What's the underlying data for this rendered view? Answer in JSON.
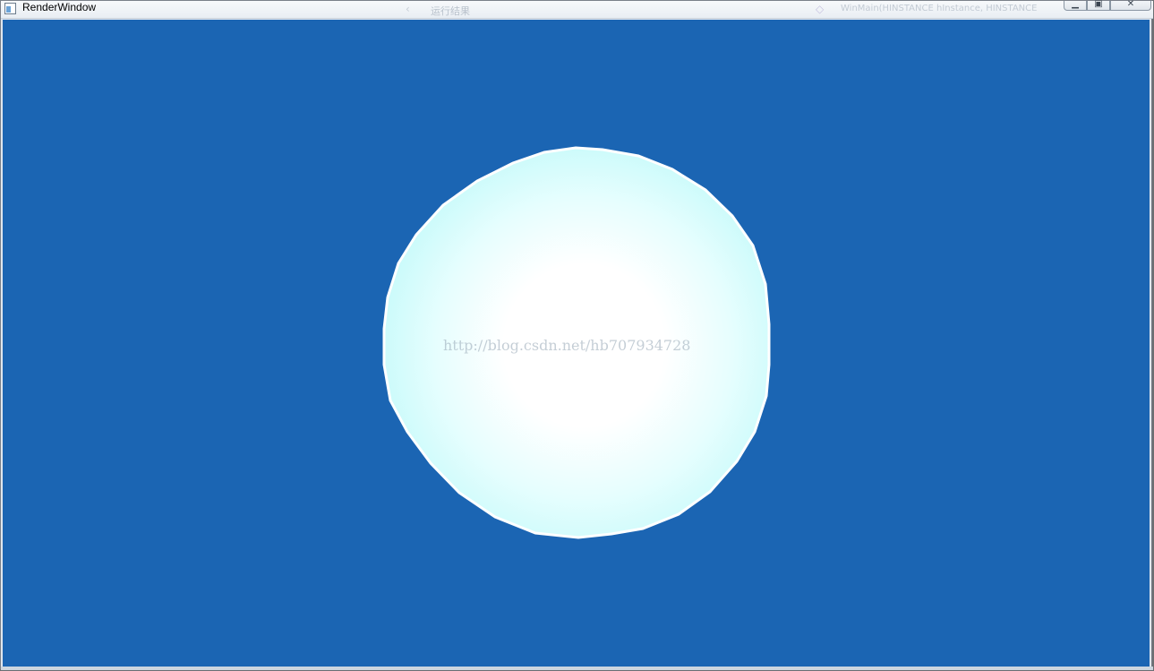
{
  "window": {
    "title": "RenderWindow",
    "title_icon": "app-window-icon",
    "background_title_fragment_1": "运行结果",
    "background_title_fragment_2": "WinMain(HINSTANCE hInstance, HINSTANCE",
    "controls": {
      "minimize_icon": "minimize-icon",
      "maximize_icon": "maximize-icon",
      "close_icon": "close-icon"
    }
  },
  "scene": {
    "background_color": "#1b65b3",
    "sphere_edge_color": "#c9fbfb",
    "sphere_highlight_color": "#ffffff",
    "watermark": "http://blog.csdn.net/hb707934728"
  }
}
